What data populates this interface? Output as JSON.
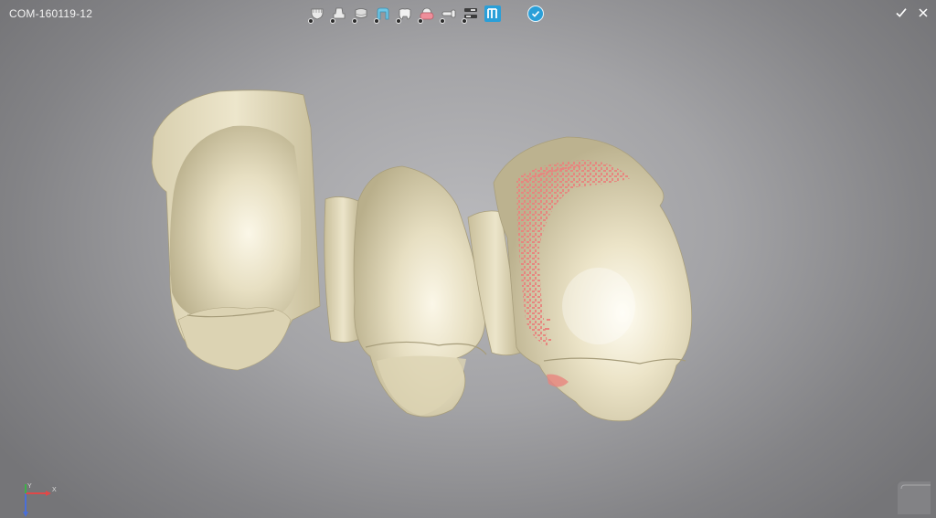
{
  "window": {
    "title": "COM-160119-12"
  },
  "toolbar": {
    "items": [
      {
        "name": "jaw-icon"
      },
      {
        "name": "die-icon"
      },
      {
        "name": "margin-icon"
      },
      {
        "name": "coping-icon"
      },
      {
        "name": "crown-icon"
      },
      {
        "name": "gingiva-icon"
      },
      {
        "name": "connector-icon"
      },
      {
        "name": "settings-icon"
      },
      {
        "name": "bridge-icon"
      }
    ],
    "accent": "#2a9fd8"
  },
  "colors": {
    "tooth": "#e4dcbf",
    "tooth_shadow": "#b7ad8a",
    "contact_marks": "#e8847e"
  },
  "axis": {
    "x_label": "X",
    "y_label": "Y"
  }
}
